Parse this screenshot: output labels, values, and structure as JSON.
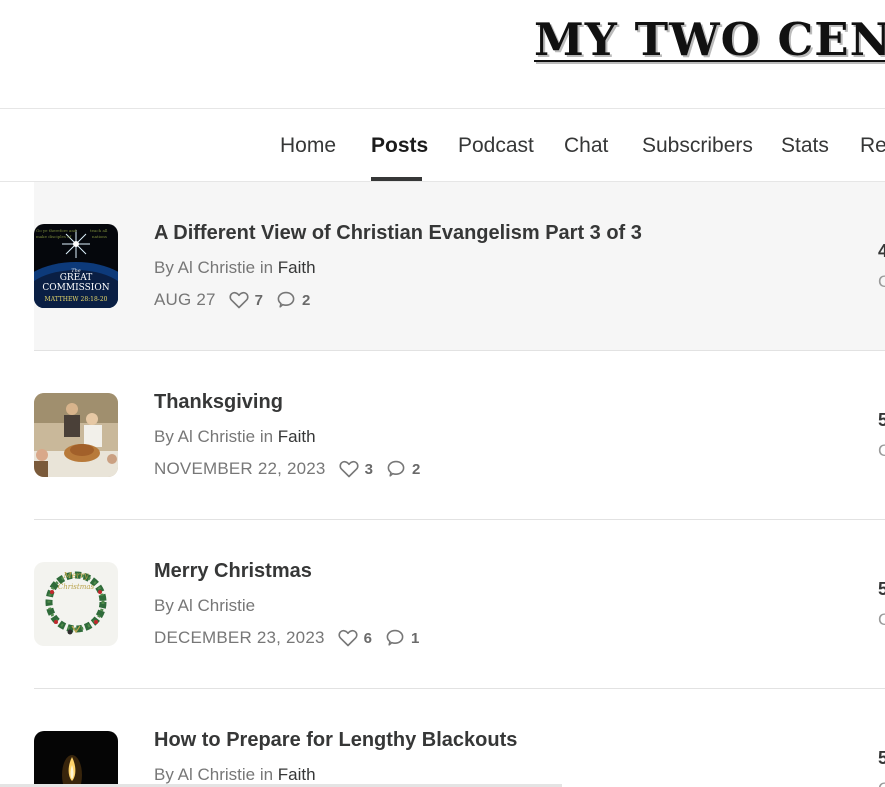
{
  "site": {
    "logo_text": "MY TWO CENTS"
  },
  "nav": {
    "items": [
      "Home",
      "Posts",
      "Podcast",
      "Chat",
      "Subscribers",
      "Stats",
      "Re"
    ],
    "active": "Posts"
  },
  "posts": [
    {
      "title": "A Different View of Christian Evangelism Part 3 of 3",
      "by": "By Al Christie",
      "in": "in",
      "category": "Faith",
      "date": "AUG 27",
      "likes": "7",
      "comments": "2",
      "right_top": "4",
      "right_bottom": "C",
      "thumb_text": {
        "line1": "The",
        "line2": "GREAT",
        "line3": "COMMISSION",
        "line4": "MATTHEW 28:18-20"
      }
    },
    {
      "title": "Thanksgiving",
      "by": "By Al Christie",
      "in": "in",
      "category": "Faith",
      "date": "NOVEMBER 22, 2023",
      "likes": "3",
      "comments": "2",
      "right_top": "5",
      "right_bottom": "C"
    },
    {
      "title": "Merry Christmas",
      "by": "By Al Christie",
      "in": "",
      "category": "",
      "date": "DECEMBER 23, 2023",
      "likes": "6",
      "comments": "1",
      "right_top": "5",
      "right_bottom": "C",
      "thumb_text": {
        "line1": "Merry",
        "line2": "Christmas"
      }
    },
    {
      "title": "How to Prepare for Lengthy Blackouts",
      "by": "By Al Christie",
      "in": "in",
      "category": "Faith",
      "right_top": "5",
      "right_bottom": "C"
    }
  ],
  "colors": {
    "text": "#363737",
    "muted": "#777777",
    "highlight_row": "#f6f6f6",
    "divider": "#e2e2e2"
  },
  "icons": {
    "like": "heart-icon",
    "comment": "comment-bubble-icon"
  }
}
